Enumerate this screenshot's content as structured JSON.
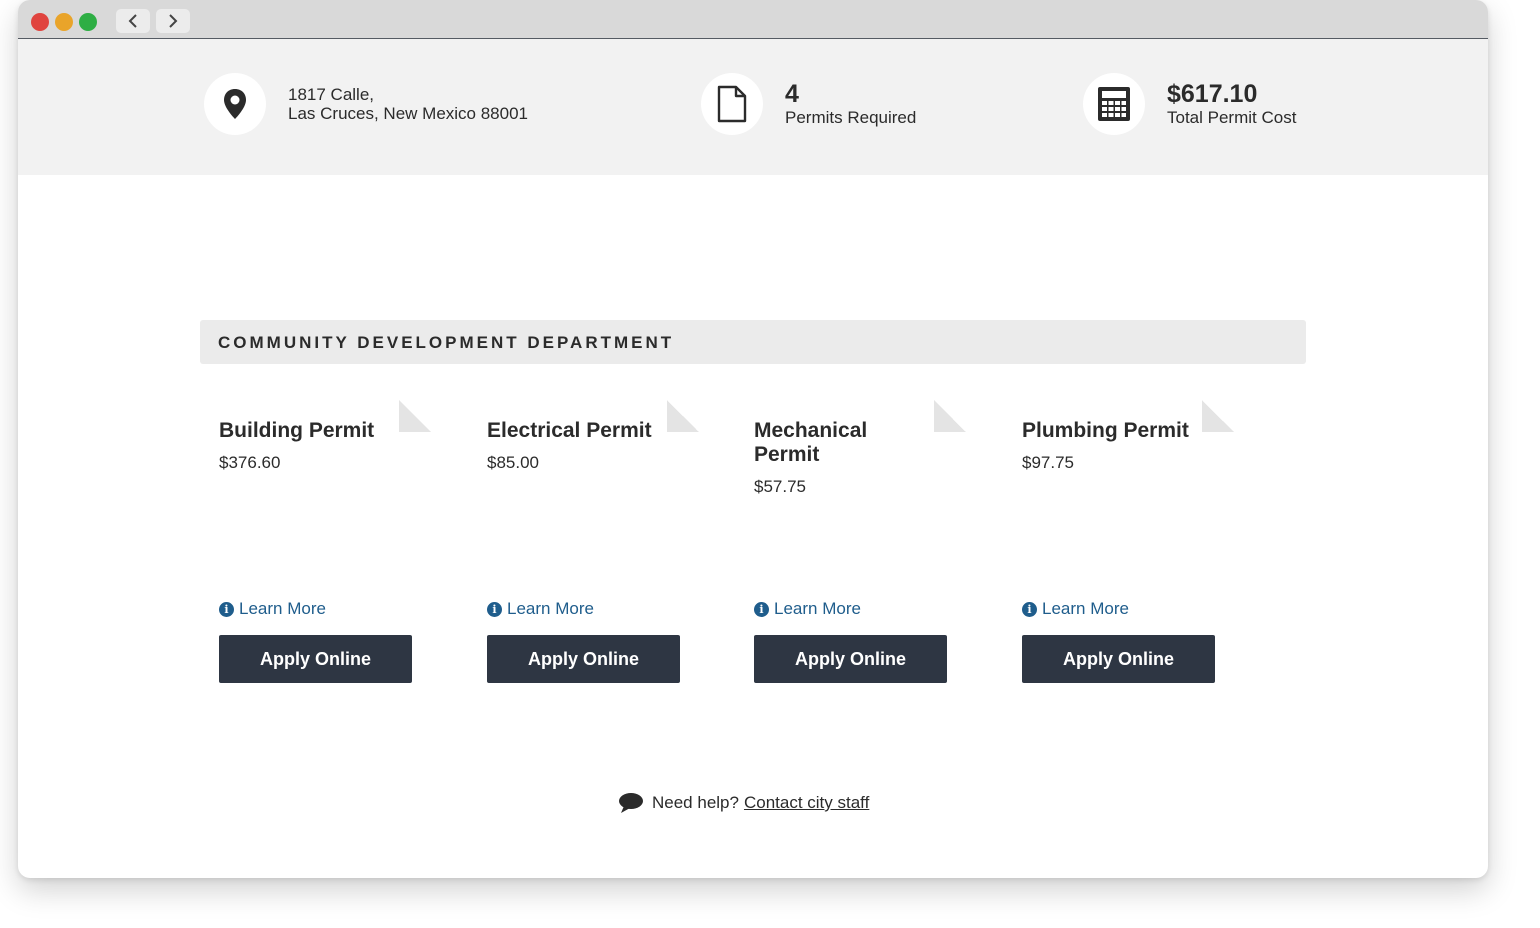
{
  "summary": {
    "address_line1": "1817 Calle,",
    "address_line2": "Las Cruces, New Mexico 88001",
    "permit_count": "4",
    "permit_count_label": "Permits Required",
    "total_cost": "$617.10",
    "total_cost_label": "Total Permit Cost"
  },
  "department": {
    "title": "COMMUNITY DEVELOPMENT DEPARTMENT"
  },
  "permits": [
    {
      "name": "Building Permit",
      "price": "$376.60",
      "learn_more": "Learn More",
      "apply": "Apply Online"
    },
    {
      "name": "Electrical Permit",
      "price": "$85.00",
      "learn_more": "Learn More",
      "apply": "Apply Online"
    },
    {
      "name": "Mechanical Permit",
      "price": "$57.75",
      "learn_more": "Learn More",
      "apply": "Apply Online"
    },
    {
      "name": "Plumbing Permit",
      "price": "$97.75",
      "learn_more": "Learn More",
      "apply": "Apply Online"
    }
  ],
  "help": {
    "text": "Need help?",
    "link": "Contact city staff"
  },
  "colors": {
    "button": "#2e3643",
    "link": "#1f5d8c",
    "summary_bg": "#f2f2f2"
  },
  "icons": {
    "location": "map-pin-icon",
    "document": "document-icon",
    "cost": "calculator-icon",
    "info": "info-icon",
    "help": "chat-bubble-icon"
  }
}
